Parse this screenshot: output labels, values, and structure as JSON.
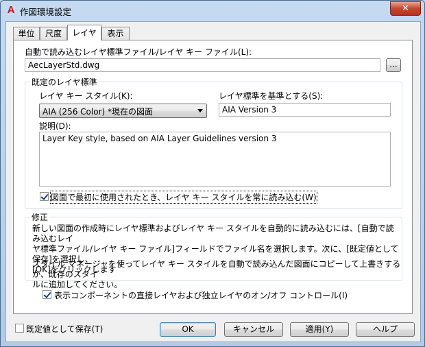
{
  "window": {
    "title": "作図環境設定",
    "app_icon_glyph": "A",
    "close_glyph": "✕"
  },
  "tabs": [
    {
      "label": "単位",
      "active": false
    },
    {
      "label": "尺度",
      "active": false
    },
    {
      "label": "レイヤ",
      "active": true
    },
    {
      "label": "表示",
      "active": false
    }
  ],
  "auto_load": {
    "label": "自動で読み込むレイヤ標準ファイル/レイヤ キー ファイル(L):",
    "value": "AecLayerStd.dwg",
    "browse_label": "..."
  },
  "default_standard": {
    "group_title": "既定のレイヤ標準",
    "key_style_label": "レイヤ キー スタイル(K):",
    "key_style_value": "AIA (256 Color) *現在の図面",
    "based_on_label": "レイヤ標準を基準とする(S):",
    "based_on_value": "AIA Version 3",
    "description_label": "説明(D):",
    "description_value": "Layer Key style, based on AIA Layer Guidelines version 3",
    "always_import_label": "図面で最初に使用されたとき、レイヤ キー スタイルを常に読み込む(W)",
    "always_import_checked": true
  },
  "notes": {
    "group_title": "修正",
    "paragraph1_line1": "新しい図面の作成時にレイヤ標準およびレイヤ キー スタイルを自動的に読み込むには、[自動で読み込むレイ",
    "paragraph1_line2": "ヤ標準ファイル/レイヤ キー ファイル]フィールドでファイル名を選択します。次に、[既定値として保存]を選択し、",
    "paragraph1_line3": "[OK]をクリックします",
    "paragraph2_line1": "スタイル マネージャを使ってレイヤ キー スタイルを自動で読み込んだ図面にコピーして上書きするか、既存のスタイ",
    "paragraph2_line2": "ルに追加してください。"
  },
  "component_control": {
    "label": "表示コンポーネントの直接レイヤおよび独立レイヤのオン/オフ コントロール(I)",
    "checked": true
  },
  "footer": {
    "save_default_label": "既定値として保存(T)",
    "save_default_checked": false,
    "ok_label": "OK",
    "cancel_label": "キャンセル",
    "apply_label": "適用(Y)",
    "help_label": "ヘルプ"
  },
  "colors": {
    "titlebar": "#c5daf0",
    "close_button": "#c7462f",
    "app_icon": "#c8161d"
  }
}
